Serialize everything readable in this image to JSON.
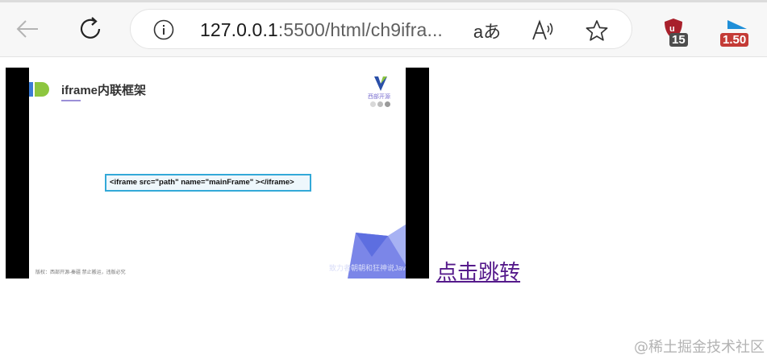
{
  "browser": {
    "url_host": "127.0.0.1",
    "url_rest": ":5500/html/ch9ifra...",
    "read_mode_label": "aあ",
    "extensions": [
      {
        "icon": "ublock-origin-shield-icon",
        "badge": "15",
        "color": "#a8202b"
      },
      {
        "icon": "blue-extension-icon",
        "badge": "1.50",
        "color": "#1f8fd8"
      }
    ]
  },
  "iframe": {
    "slide_title": "iframe内联框架",
    "brand": "西部开源",
    "code": "<iframe src=\"path\" name=\"mainFrame\" ></iframe>",
    "footer_left": "版权：西部开源-秦疆    禁止搬运，违版必究",
    "footer_right": "致力者朝朝和狂神说Java"
  },
  "page": {
    "link_text": "点击跳转"
  },
  "watermark": "@稀土掘金技术社区",
  "colors": {
    "link_visited": "#551a8b",
    "code_border": "#33a9d8",
    "logo_green": "#8dc63f",
    "logo_blue": "#3a7bd5"
  }
}
